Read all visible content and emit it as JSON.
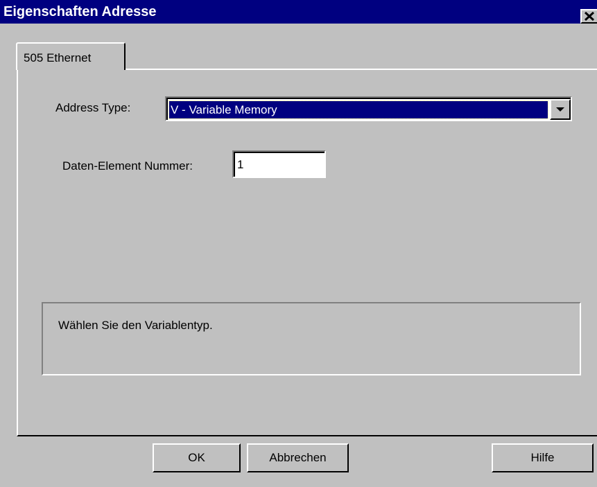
{
  "window": {
    "title": "Eigenschaften Adresse",
    "close_icon": "close-icon"
  },
  "tabs": [
    {
      "label": "505 Ethernet",
      "selected": true
    }
  ],
  "form": {
    "address_type_label": "Address Type:",
    "address_type_value": "V - Variable Memory",
    "dropdown_icon": "chevron-down-icon",
    "data_element_label": "Daten-Element Nummer:",
    "data_element_value": "1"
  },
  "hint": {
    "text": "Wählen Sie den Variablentyp."
  },
  "buttons": {
    "ok": "OK",
    "cancel": "Abbrechen",
    "help": "Hilfe"
  },
  "colors": {
    "titlebar": "#000080",
    "face": "#c0c0c0",
    "selection": "#000080"
  }
}
